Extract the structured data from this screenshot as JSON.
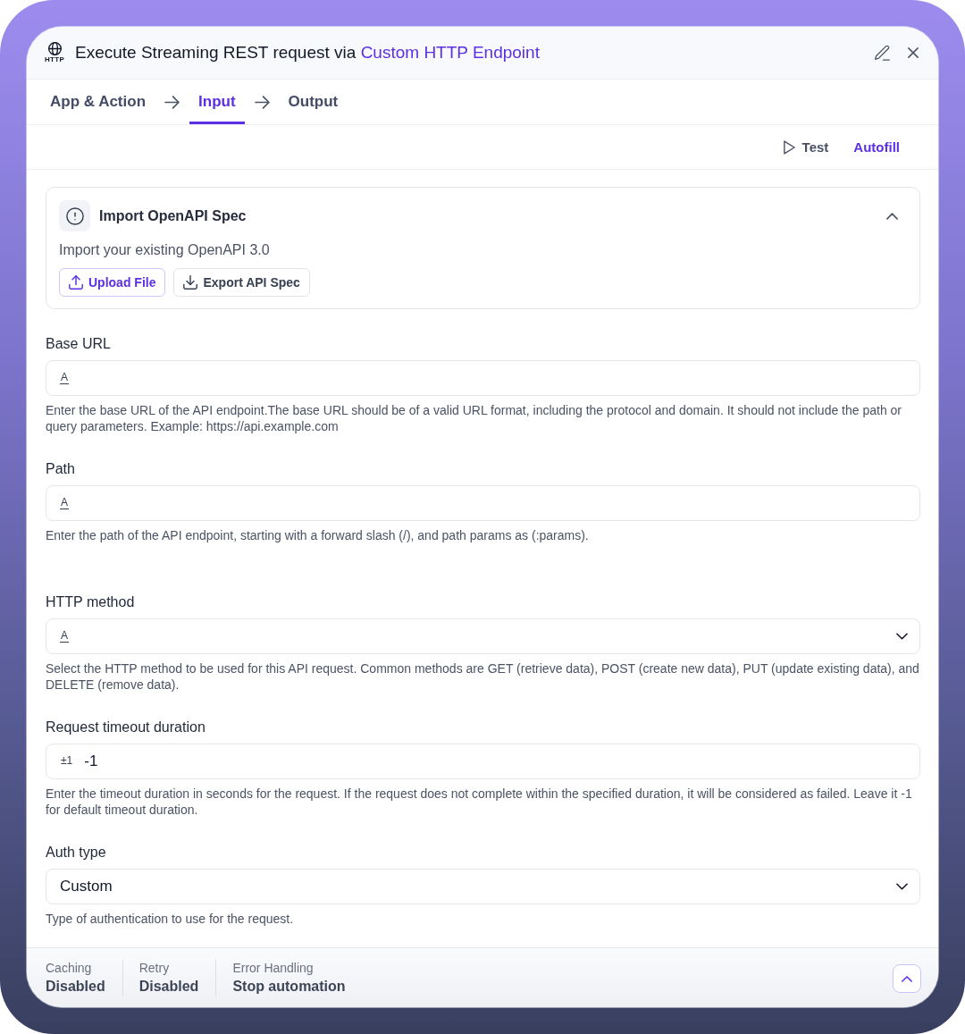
{
  "header": {
    "app_icon_label": "HTTP",
    "title": "Execute Streaming REST request via",
    "title_link": "Custom HTTP Endpoint"
  },
  "steps": [
    {
      "label": "App & Action",
      "selected": false
    },
    {
      "label": "Input",
      "selected": true
    },
    {
      "label": "Output",
      "selected": false
    }
  ],
  "toolbar": {
    "test_label": "Test",
    "autofill_label": "Autofill"
  },
  "import_card": {
    "title": "Import OpenAPI Spec",
    "expanded": true,
    "description": "Import your existing OpenAPI 3.0",
    "buttons": [
      {
        "label": "Upload File",
        "kind": "upload"
      },
      {
        "label": "Export API Spec",
        "kind": "export"
      }
    ]
  },
  "fields": [
    {
      "label": "Base URL",
      "kind": "input",
      "type_glyph": "A",
      "help": "Enter the base URL of the API endpoint.The base URL should be of a valid URL format, including the protocol and domain. It should not include the path or query parameters. Example: https://api.example.com"
    },
    {
      "label": "Path",
      "kind": "input",
      "type_glyph": "A",
      "help": "Enter the path of the API endpoint, starting with a forward slash (/), and path params as (:params)."
    },
    {
      "label": "HTTP method",
      "kind": "select",
      "type_glyph": "A",
      "help": "Select the HTTP method to be used for this API request. Common methods are GET (retrieve data), POST (create new data), PUT (update existing data), and DELETE (remove data)."
    },
    {
      "label": "Request timeout duration",
      "kind": "input",
      "type_glyph": "±1",
      "value": "-1",
      "help": "Enter the timeout duration in seconds for the request. If the request does not complete within the specified duration, it will be considered as failed. Leave it -1 for default timeout duration."
    },
    {
      "label": "Auth type",
      "kind": "select",
      "value": "Custom",
      "help": "Type of authentication to use for the request."
    }
  ],
  "footer": {
    "settings": [
      {
        "label": "Caching",
        "value": "Disabled"
      },
      {
        "label": "Retry",
        "value": "Disabled"
      },
      {
        "label": "Error Handling",
        "value": "Stop automation"
      }
    ]
  }
}
